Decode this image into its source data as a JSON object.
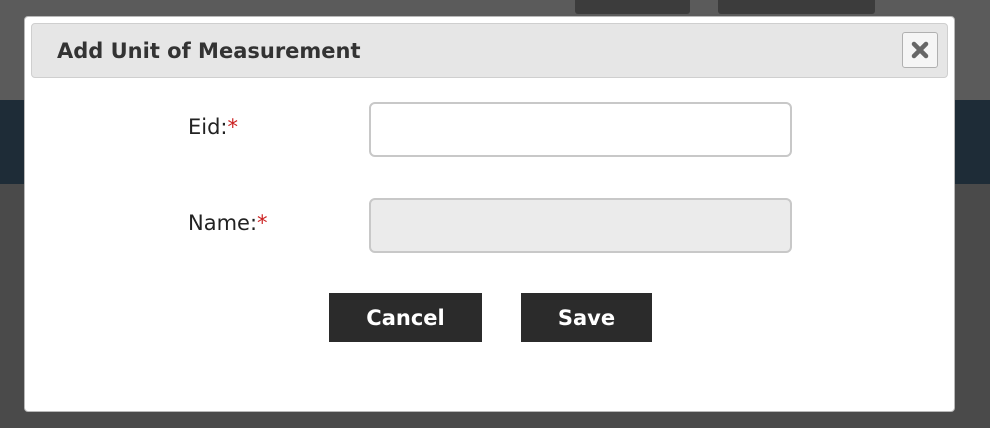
{
  "dialog": {
    "title": "Add Unit of Measurement",
    "close_icon": "close-icon"
  },
  "form": {
    "eid": {
      "label": "Eid:",
      "required_marker": "*",
      "value": ""
    },
    "name": {
      "label": "Name:",
      "required_marker": "*",
      "value": ""
    }
  },
  "buttons": {
    "cancel": "Cancel",
    "save": "Save"
  },
  "colors": {
    "button_bg": "#2b2b2b",
    "required": "#cc2222",
    "title_bar": "#e6e6e6"
  }
}
